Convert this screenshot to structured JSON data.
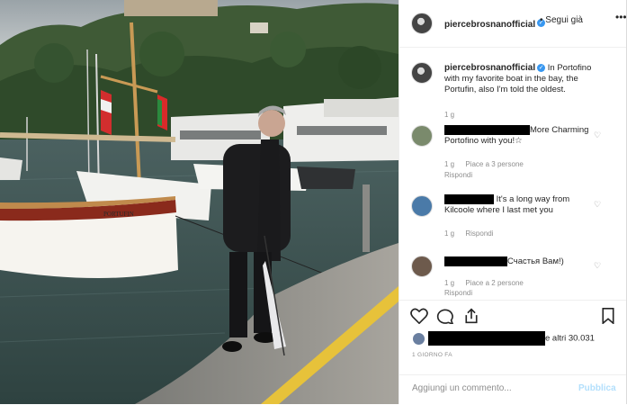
{
  "post": {
    "username": "piercebrosnanofficial",
    "follow_label": "Segui già",
    "caption": "In Portofino with my favorite boat in the bay, the Portufin, also I'm told the oldest.",
    "caption_age": "1 g",
    "boat_name": "PORTUFIN"
  },
  "comments": [
    {
      "text": "More Charming Portofino with you!☆",
      "age": "1 g",
      "likes": "Piace a 3 persone",
      "reply": "Rispondi"
    },
    {
      "text": "It's a long way from Kilcoole where I last met you",
      "age": "1 g",
      "reply": "Rispondi"
    },
    {
      "text": "Счастья Вам!)",
      "age": "1 g",
      "likes": "Piace a 2 persone",
      "reply": "Rispondi"
    }
  ],
  "likes": {
    "suffix": "e altri 30.031"
  },
  "date_label": "1 GIORNO FA",
  "add_comment": {
    "placeholder": "Aggiungi un commento...",
    "publish_label": "Pubblica"
  },
  "icons": [
    "verified-icon",
    "more-options-icon",
    "heart-icon",
    "comment-icon",
    "share-icon",
    "save-icon"
  ],
  "colors": {
    "verified": "#3897f0",
    "text": "#262626",
    "muted": "#8e8e8e",
    "publish": "#b2dffc"
  }
}
